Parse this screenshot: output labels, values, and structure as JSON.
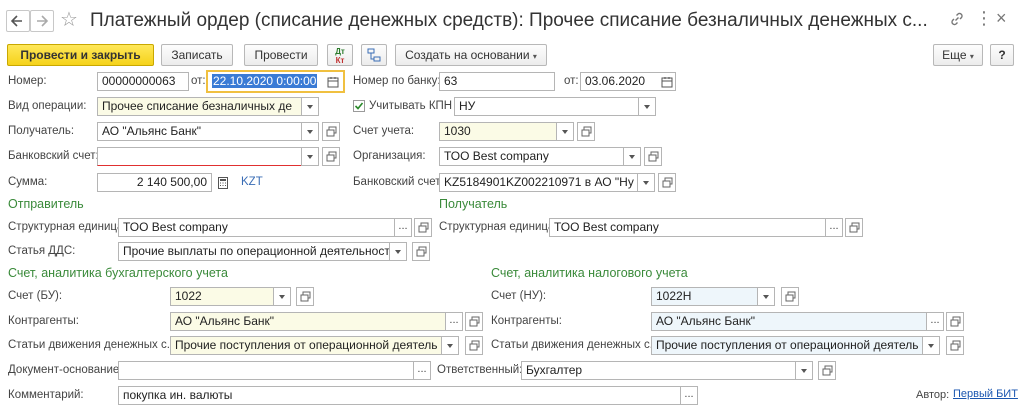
{
  "window": {
    "title": "Платежный ордер (списание денежных средств): Прочее списание безналичных денежных с..."
  },
  "toolbar": {
    "post_close": "Провести и закрыть",
    "save": "Записать",
    "post": "Провести",
    "dt_kt_top": "Дт",
    "dt_kt_bottom": "Кт",
    "create_based": "Создать на основании",
    "more": "Еще",
    "help": "?"
  },
  "header": {
    "number_label": "Номер:",
    "number_value": "00000000063",
    "from_label": "от:",
    "from_value": "22.10.2020  0:00:00",
    "bank_number_label": "Номер по банку:",
    "bank_number_value": "63",
    "bank_from_label": "от:",
    "bank_from_value": "03.06.2020",
    "operation_label": "Вид операции:",
    "operation_value": "Прочее списание безналичных де",
    "kpn_label": "Учитывать КПН",
    "kpn_value": "НУ",
    "recipient_label": "Получатель:",
    "recipient_value": "АО \"Альянс Банк\"",
    "account_label": "Счет учета:",
    "account_value": "1030",
    "bank_account_label": "Банковский счет:",
    "bank_account_value": "",
    "org_label": "Организация:",
    "org_value": "ТОО Best company",
    "sum_label": "Сумма:",
    "sum_value": "2 140 500,00",
    "currency": "KZT",
    "bank_account2_label": "Банковский счет:",
    "bank_account2_value": "KZ5184901KZ002210971 в АО \"Ну"
  },
  "sender": {
    "title": "Отправитель",
    "unit_label": "Структурная единица:",
    "unit_value": "ТОО Best company",
    "dds_label": "Статья ДДС:",
    "dds_value": "Прочие выплаты по операционной деятельност"
  },
  "receiver": {
    "title": "Получатель",
    "unit_label": "Структурная единица:",
    "unit_value": "ТОО Best company"
  },
  "accounting_bu": {
    "title": "Счет, аналитика бухгалтерского учета",
    "account_label": "Счет (БУ):",
    "account_value": "1022",
    "contractors_label": "Контрагенты:",
    "contractors_value": "АО \"Альянс Банк\"",
    "movement_label": "Статьи движения денежных с...",
    "movement_value": "Прочие поступления от операционной деятель"
  },
  "accounting_nu": {
    "title": "Счет, аналитика налогового учета",
    "account_label": "Счет (НУ):",
    "account_value": "1022Н",
    "contractors_label": "Контрагенты:",
    "contractors_value": "АО \"Альянс Банк\"",
    "movement_label": "Статьи движения денежных с...",
    "movement_value": "Прочие поступления от операционной деятель"
  },
  "footer": {
    "basis_label": "Документ-основание:",
    "basis_value": "",
    "responsible_label": "Ответственный:",
    "responsible_value": "Бухгалтер",
    "comment_label": "Комментарий:",
    "comment_value": "покупка ин. валюты",
    "author_label": "Автор:",
    "author_value": "Первый БИТ"
  },
  "colors": {
    "section_green": "#3a8a3a",
    "primary_yellow": "#f5d21a",
    "link_blue": "#1a56b0"
  }
}
